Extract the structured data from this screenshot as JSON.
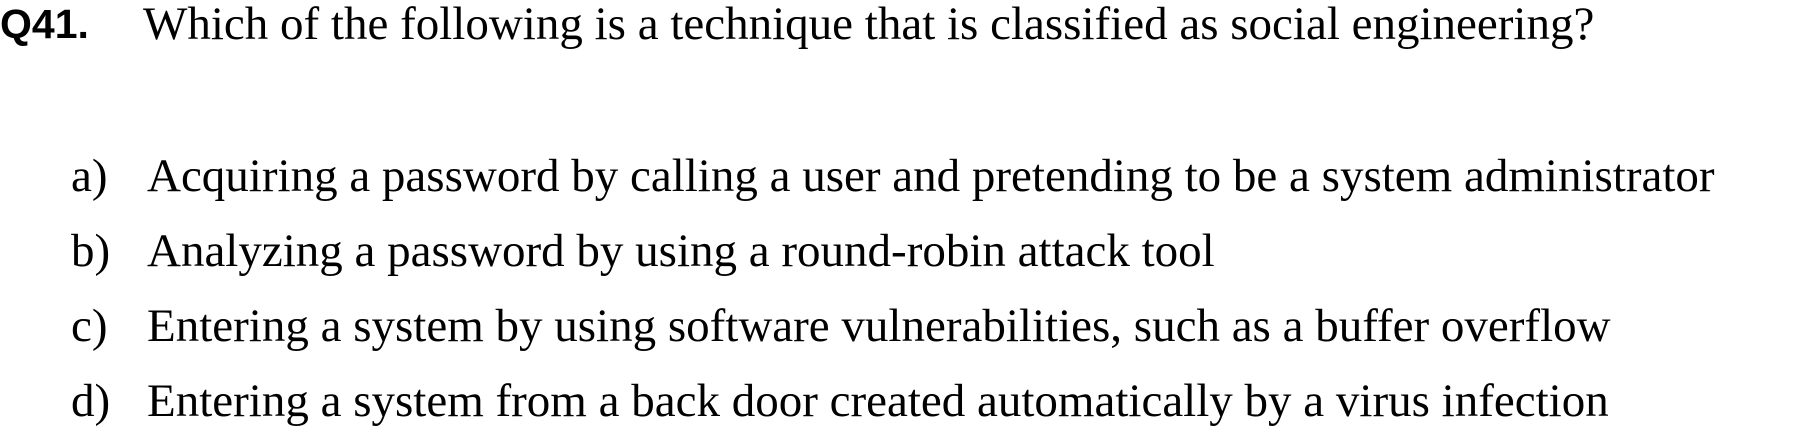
{
  "question": {
    "number": "Q41.",
    "text": "Which of the following is a technique that is classified as social engineering?"
  },
  "options": [
    {
      "label": "a)",
      "text": "Acquiring a password by calling a user and pretending to be a system administrator"
    },
    {
      "label": "b)",
      "text": "Analyzing a password by using a round-robin attack tool"
    },
    {
      "label": "c)",
      "text": "Entering a system by using software vulnerabilities, such as a buffer overflow"
    },
    {
      "label": "d)",
      "text": "Entering a system from a back door created automatically by a virus infection"
    }
  ]
}
